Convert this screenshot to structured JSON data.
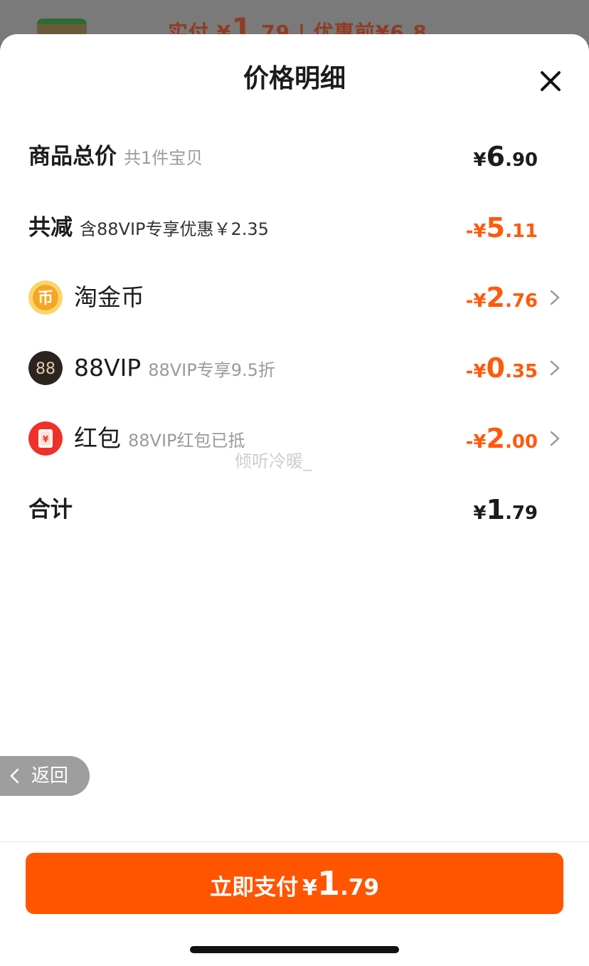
{
  "background": {
    "prefix": "实付 ¥",
    "price_int": "1",
    "price_dec": ".79",
    "original": " | 优惠前¥6.8"
  },
  "sheet": {
    "title": "价格明细"
  },
  "rows": {
    "total": {
      "label": "商品总价",
      "sub": "共1件宝贝",
      "cur": "¥",
      "int": "6",
      "dec": ".90"
    },
    "reduced": {
      "label": "共减",
      "sub": "含88VIP专享优惠￥2.35",
      "cur": "-¥",
      "int": "5",
      "dec": ".11"
    },
    "coins": {
      "label": "淘金币",
      "cur": "-¥",
      "int": "2",
      "dec": ".76",
      "icon": "coin-icon"
    },
    "vip": {
      "label": "88VIP",
      "sub": "88VIP专享9.5折",
      "cur": "-¥",
      "int": "0",
      "dec": ".35",
      "icon": "vip88-icon"
    },
    "redpacket": {
      "label": "红包",
      "sub": "88VIP红包已抵",
      "cur": "-¥",
      "int": "2",
      "dec": ".00",
      "icon": "red-packet-icon"
    },
    "sum": {
      "label": "合计",
      "cur": "¥",
      "int": "1",
      "dec": ".79"
    }
  },
  "back": {
    "label": "返回"
  },
  "watermark": "倾听冷暖_",
  "pay": {
    "label": "立即支付",
    "cur": "¥",
    "int": "1",
    "dec": ".79"
  },
  "colors": {
    "accent": "#ff5500",
    "discount": "#ff5a0a",
    "coin": "#f5a623",
    "red": "#f0302a"
  }
}
